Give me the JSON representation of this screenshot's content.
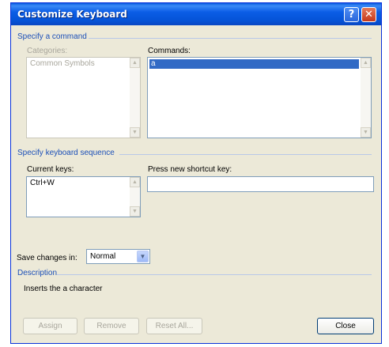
{
  "window": {
    "title": "Customize Keyboard",
    "help_glyph": "?",
    "close_glyph": "✕"
  },
  "command_group": {
    "header": "Specify a command",
    "categories_label": "Categories:",
    "categories_items": [
      "Common Symbols"
    ],
    "commands_label": "Commands:",
    "commands_items": [
      "a"
    ],
    "commands_selected_index": 0
  },
  "keyboard_group": {
    "header": "Specify keyboard sequence",
    "current_keys_label": "Current keys:",
    "current_keys_items": [
      "Ctrl+W"
    ],
    "new_shortcut_label": "Press new shortcut key:",
    "new_shortcut_value": ""
  },
  "save_changes": {
    "label": "Save changes in:",
    "value": "Normal"
  },
  "description": {
    "header": "Description",
    "text": "Inserts the a character"
  },
  "buttons": {
    "assign": "Assign",
    "remove": "Remove",
    "reset_all": "Reset All...",
    "close": "Close"
  },
  "icons": {
    "scroll_up": "▲",
    "scroll_down": "▼",
    "dropdown": "▼"
  }
}
